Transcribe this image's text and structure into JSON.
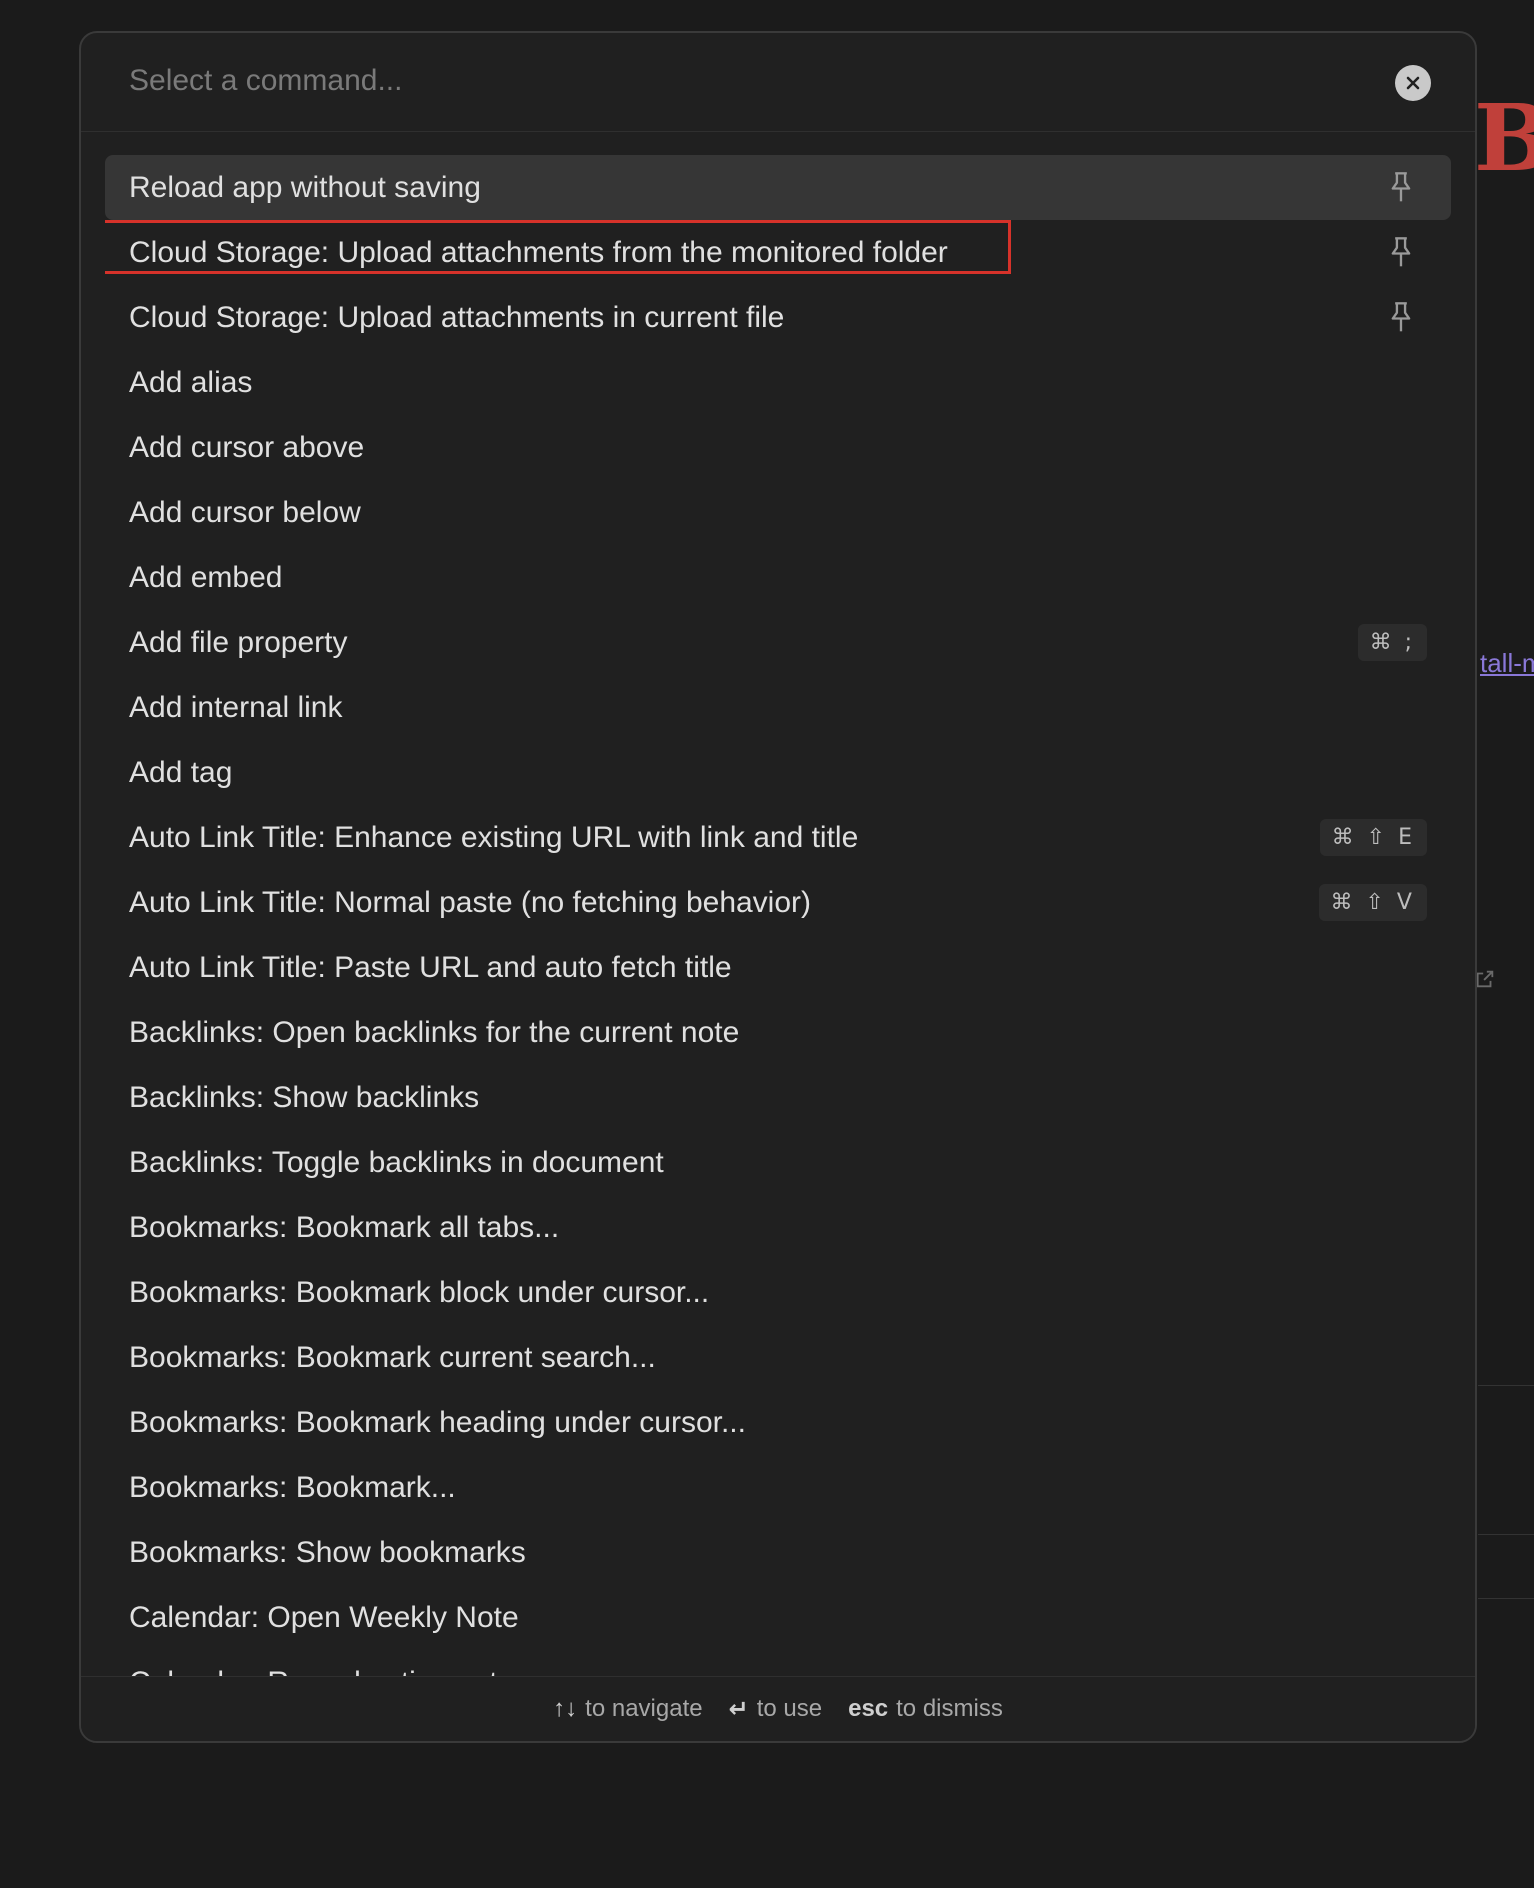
{
  "background": {
    "heading_fragment": "B",
    "link_fragment": "tall-m",
    "accent_color": "#c0403a",
    "link_color": "#8a78d8"
  },
  "palette": {
    "search": {
      "placeholder": "Select a command...",
      "value": ""
    },
    "items": [
      {
        "label": "Reload app without saving",
        "pinned": true,
        "selected": true,
        "hotkey": ""
      },
      {
        "label": "Cloud Storage: Upload attachments from the monitored folder",
        "pinned": true,
        "selected": false,
        "hotkey": ""
      },
      {
        "label": "Cloud Storage: Upload attachments in current file",
        "pinned": true,
        "selected": false,
        "hotkey": ""
      },
      {
        "label": "Add alias",
        "pinned": false,
        "selected": false,
        "hotkey": ""
      },
      {
        "label": "Add cursor above",
        "pinned": false,
        "selected": false,
        "hotkey": ""
      },
      {
        "label": "Add cursor below",
        "pinned": false,
        "selected": false,
        "hotkey": ""
      },
      {
        "label": "Add embed",
        "pinned": false,
        "selected": false,
        "hotkey": ""
      },
      {
        "label": "Add file property",
        "pinned": false,
        "selected": false,
        "hotkey": "⌘ ;"
      },
      {
        "label": "Add internal link",
        "pinned": false,
        "selected": false,
        "hotkey": ""
      },
      {
        "label": "Add tag",
        "pinned": false,
        "selected": false,
        "hotkey": ""
      },
      {
        "label": "Auto Link Title: Enhance existing URL with link and title",
        "pinned": false,
        "selected": false,
        "hotkey": "⌘ ⇧ E"
      },
      {
        "label": "Auto Link Title: Normal paste (no fetching behavior)",
        "pinned": false,
        "selected": false,
        "hotkey": "⌘ ⇧ V"
      },
      {
        "label": "Auto Link Title: Paste URL and auto fetch title",
        "pinned": false,
        "selected": false,
        "hotkey": ""
      },
      {
        "label": "Backlinks: Open backlinks for the current note",
        "pinned": false,
        "selected": false,
        "hotkey": ""
      },
      {
        "label": "Backlinks: Show backlinks",
        "pinned": false,
        "selected": false,
        "hotkey": ""
      },
      {
        "label": "Backlinks: Toggle backlinks in document",
        "pinned": false,
        "selected": false,
        "hotkey": ""
      },
      {
        "label": "Bookmarks: Bookmark all tabs...",
        "pinned": false,
        "selected": false,
        "hotkey": ""
      },
      {
        "label": "Bookmarks: Bookmark block under cursor...",
        "pinned": false,
        "selected": false,
        "hotkey": ""
      },
      {
        "label": "Bookmarks: Bookmark current search...",
        "pinned": false,
        "selected": false,
        "hotkey": ""
      },
      {
        "label": "Bookmarks: Bookmark heading under cursor...",
        "pinned": false,
        "selected": false,
        "hotkey": ""
      },
      {
        "label": "Bookmarks: Bookmark...",
        "pinned": false,
        "selected": false,
        "hotkey": ""
      },
      {
        "label": "Bookmarks: Show bookmarks",
        "pinned": false,
        "selected": false,
        "hotkey": ""
      },
      {
        "label": "Calendar: Open Weekly Note",
        "pinned": false,
        "selected": false,
        "hotkey": ""
      },
      {
        "label": "Calendar: Reveal active note",
        "pinned": false,
        "selected": false,
        "hotkey": ""
      }
    ],
    "highlighted_item_index": 1,
    "highlight_color": "#d6322a",
    "footer": {
      "navigate_keys": "↑↓",
      "navigate_text": "to navigate",
      "use_key": "↵",
      "use_text": "to use",
      "dismiss_key": "esc",
      "dismiss_text": "to dismiss"
    }
  }
}
